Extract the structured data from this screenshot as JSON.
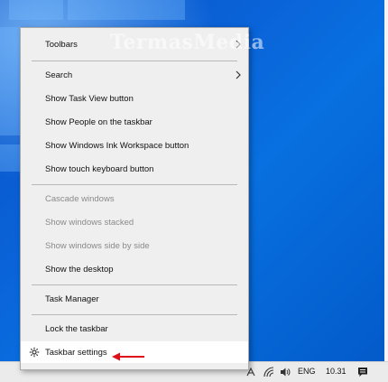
{
  "watermark": "TermasMedia",
  "context_menu": {
    "items": [
      {
        "label": "Toolbars"
      },
      {
        "label": "Search"
      },
      {
        "label": "Show Task View button"
      },
      {
        "label": "Show People on the taskbar"
      },
      {
        "label": "Show Windows Ink Workspace button"
      },
      {
        "label": "Show touch keyboard button"
      },
      {
        "label": "Cascade windows"
      },
      {
        "label": "Show windows stacked"
      },
      {
        "label": "Show windows side by side"
      },
      {
        "label": "Show the desktop"
      },
      {
        "label": "Task Manager"
      },
      {
        "label": "Lock the taskbar"
      },
      {
        "label": "Taskbar settings"
      }
    ]
  },
  "taskbar": {
    "language": "ENG",
    "clock": "10.31"
  },
  "colors": {
    "menu_background": "#efefef",
    "highlight": "#ffffff",
    "disabled_text": "#8a8a8a",
    "annotation_arrow": "#e0101a",
    "desktop": "#0a63d8"
  },
  "icons": {
    "submenu": "chevron-right-icon",
    "settings": "gear-icon",
    "annotation": "red-arrow-icon",
    "tray": [
      "ink-icon",
      "network-icon",
      "volume-icon",
      "notification-icon"
    ]
  }
}
